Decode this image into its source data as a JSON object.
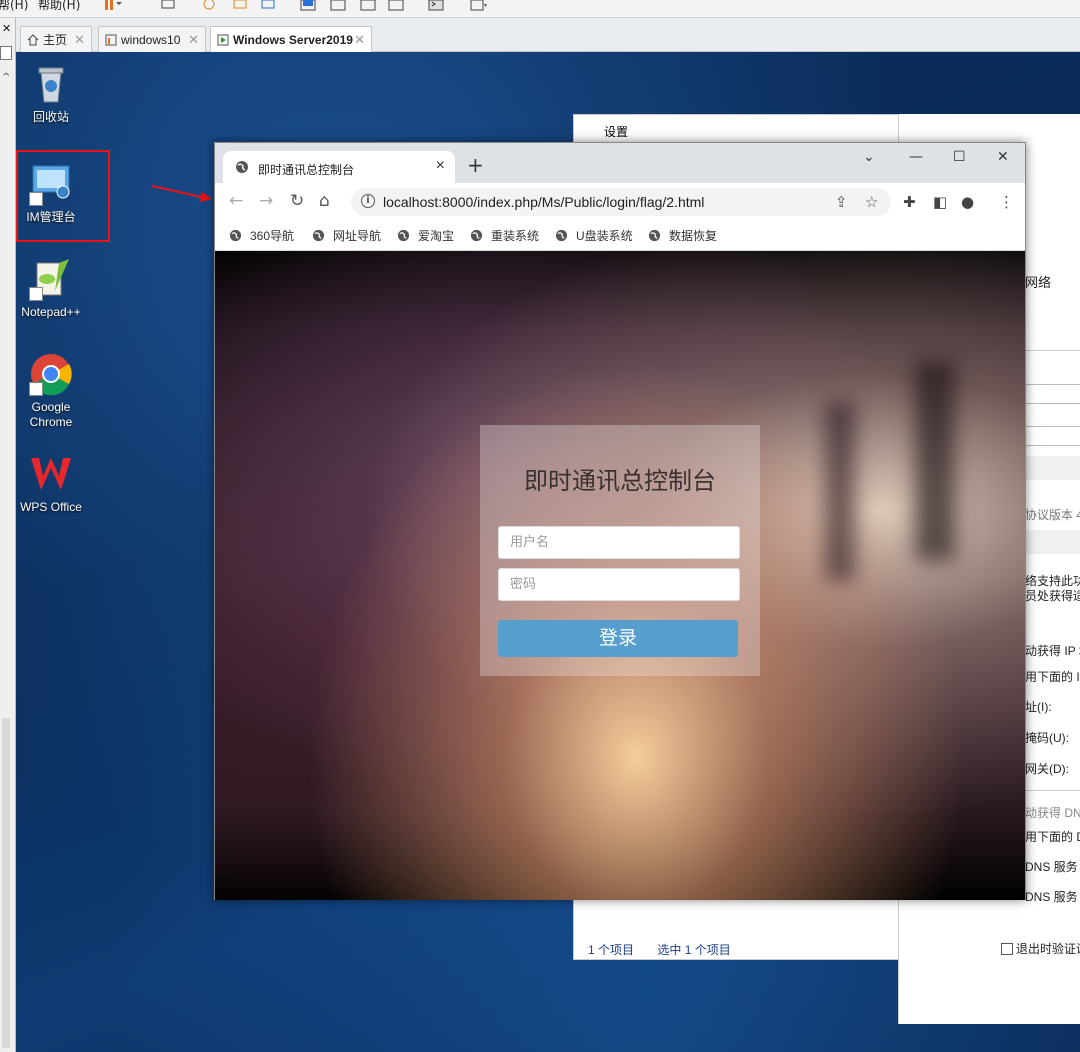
{
  "vm_toolbar": {
    "menus": [
      "帮(H)",
      "帮助(H)"
    ]
  },
  "vm_tabs": [
    {
      "label": "主页",
      "active": false,
      "icon": "home-icon"
    },
    {
      "label": "windows10",
      "active": false,
      "icon": "vm-icon"
    },
    {
      "label": "Windows Server2019",
      "active": true,
      "icon": "vm-running-icon"
    }
  ],
  "desktop_icons": [
    {
      "label": "回收站",
      "icon": "recycle-bin-icon"
    },
    {
      "label": "IM管理台",
      "icon": "im-console-icon"
    },
    {
      "label": "Notepad++",
      "icon": "notepad-plus-plus-icon"
    },
    {
      "label": "Google Chrome",
      "icon": "chrome-icon"
    },
    {
      "label": "WPS Office",
      "icon": "wps-icon"
    }
  ],
  "background_window": {
    "title": "设置",
    "status_items": "1 个项目",
    "status_selected": "选中 1 个项目"
  },
  "properties_dialog": {
    "lines": [
      "网络",
      "协议版本 4 (",
      "络支持此功能",
      "员处获得适当",
      "动获得 IP 地",
      "用下面的 IP",
      "址(I):",
      "掩码(U):",
      "网关(D):",
      "动获得 DN",
      "用下面的 D",
      "DNS 服务",
      "DNS 服务"
    ],
    "checkbox_label": "退出时验证设"
  },
  "chrome": {
    "tab_title": "即时通讯总控制台",
    "url": "localhost:8000/index.php/Ms/Public/login/flag/2.html",
    "bookmarks": [
      "360导航",
      "网址导航",
      "爱淘宝",
      "重装系统",
      "U盘装系统",
      "数据恢复"
    ]
  },
  "login": {
    "title": "即时通讯总控制台",
    "username_placeholder": "用户名",
    "password_placeholder": "密码",
    "submit_label": "登录",
    "button_color": "#569fcd"
  }
}
